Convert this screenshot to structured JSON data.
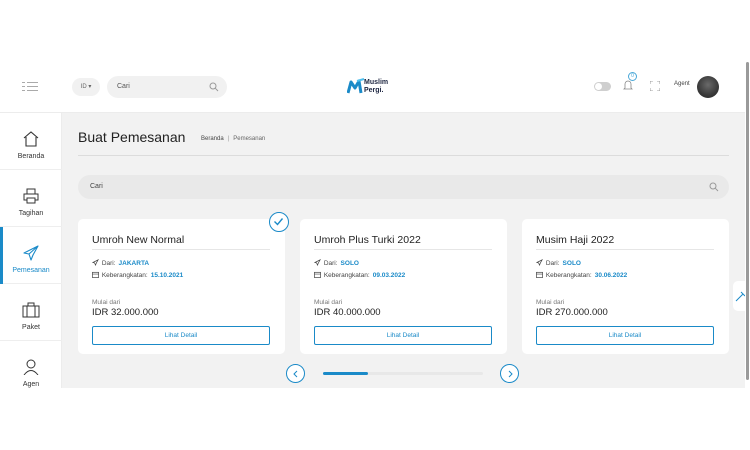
{
  "header": {
    "language": "ID",
    "search_placeholder": "Cari",
    "brand_line1": "Muslim",
    "brand_line2": "Pergi.",
    "notification_count": "0",
    "agent_label": "Agent"
  },
  "sidebar": {
    "items": [
      {
        "label": "Beranda",
        "icon": "home-icon"
      },
      {
        "label": "Tagihan",
        "icon": "printer-icon"
      },
      {
        "label": "Pemesanan",
        "icon": "airplane-icon",
        "active": true
      },
      {
        "label": "Paket",
        "icon": "luggage-icon"
      },
      {
        "label": "Agen",
        "icon": "agent-icon"
      }
    ]
  },
  "main": {
    "title": "Buat Pemesanan",
    "breadcrumb": [
      "Beranda",
      "Pemesanan"
    ],
    "search_placeholder": "Cari",
    "cards": [
      {
        "name": "Umroh New Normal",
        "from_label": "Dari:",
        "from": "JAKARTA",
        "depart_label": "Keberangkatan:",
        "date": "15.10.2021",
        "start_label": "Mulai dari",
        "price": "IDR 32.000.000",
        "button": "Lihat Detail",
        "selected": true
      },
      {
        "name": "Umroh Plus Turki 2022",
        "from_label": "Dari:",
        "from": "SOLO",
        "depart_label": "Keberangkatan:",
        "date": "09.03.2022",
        "start_label": "Mulai dari",
        "price": "IDR 40.000.000",
        "button": "Lihat Detail"
      },
      {
        "name": "Musim Haji 2022",
        "from_label": "Dari:",
        "from": "SOLO",
        "depart_label": "Keberangkatan:",
        "date": "30.06.2022",
        "start_label": "Mulai dari",
        "price": "IDR 270.000.000",
        "button": "Lihat Detail"
      }
    ],
    "carousel_progress": 0.28
  },
  "colors": {
    "accent": "#1a8ac8",
    "background": "#f2f2f2"
  }
}
